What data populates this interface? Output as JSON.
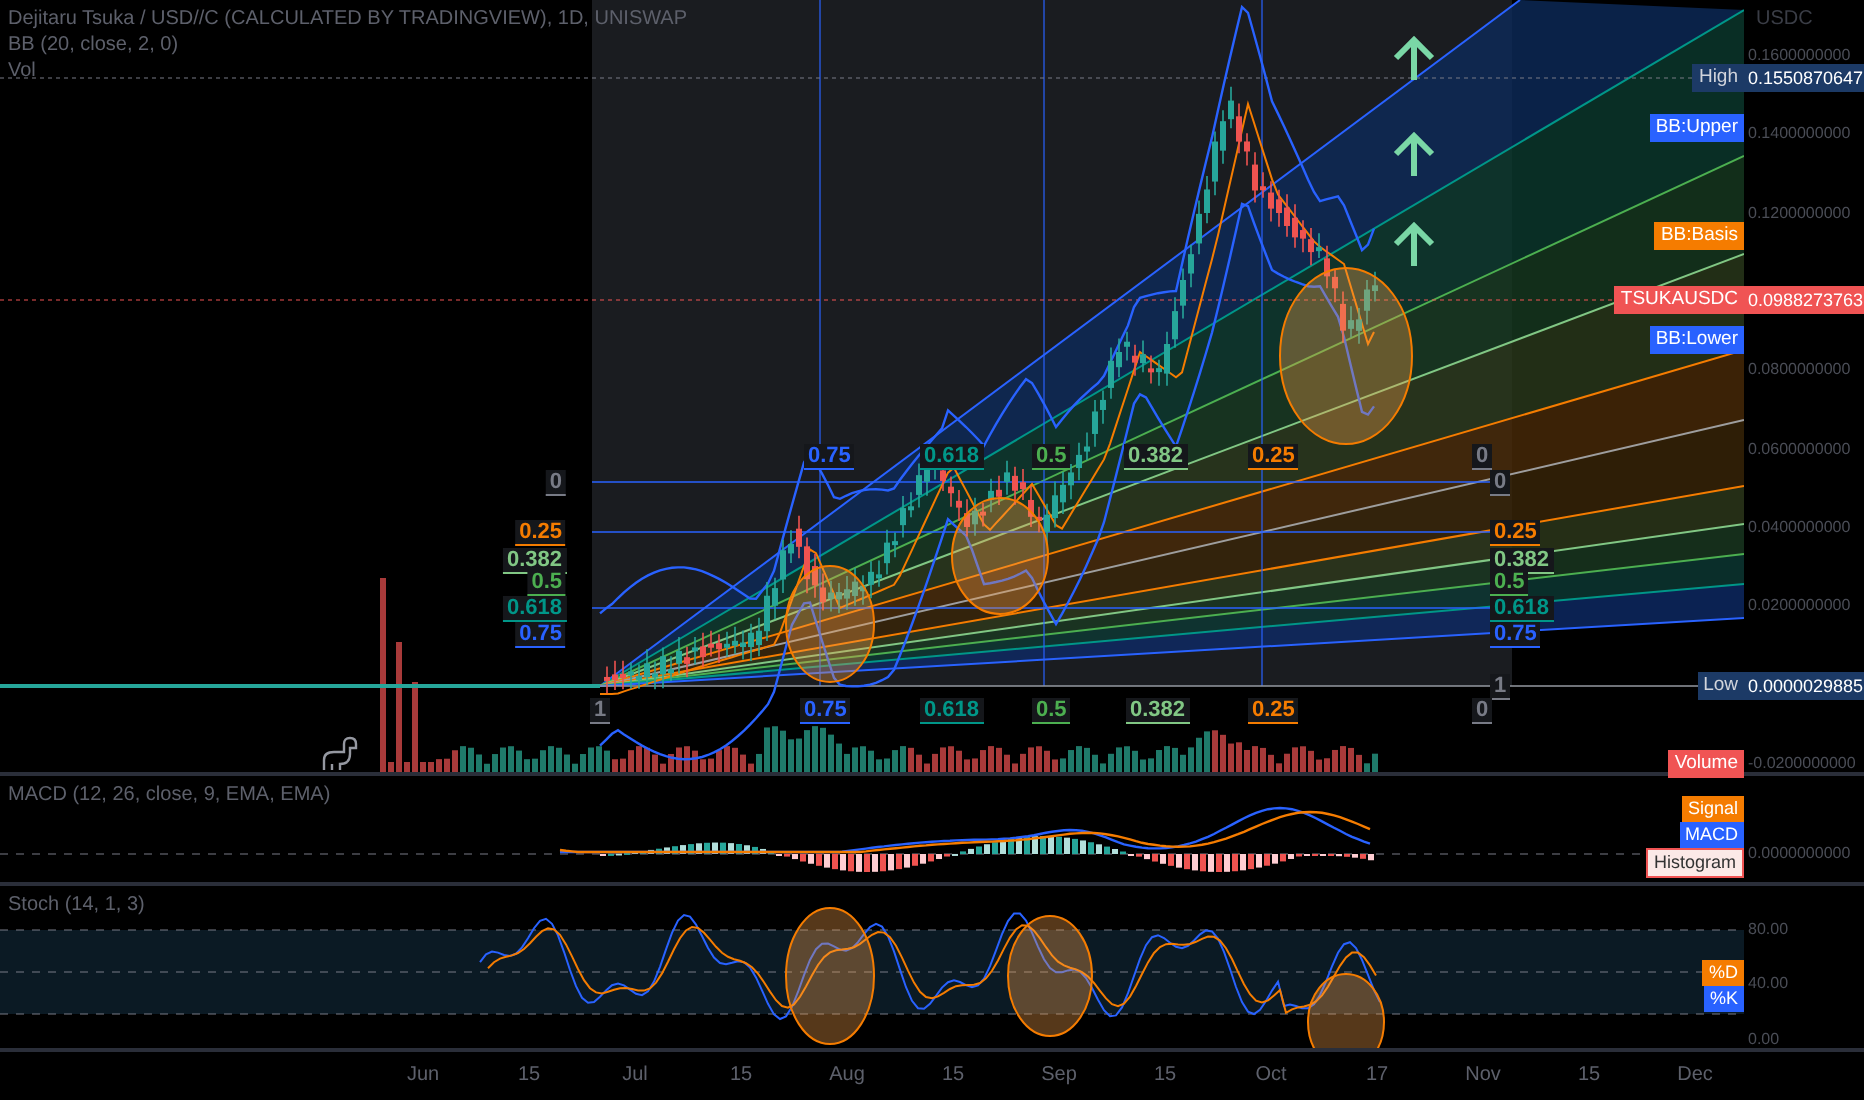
{
  "legend": {
    "title": "Dejitaru Tsuka / USD//C (CALCULATED BY TRADINGVIEW), 1D, UNISWAP",
    "indicators": [
      "BB (20, close, 2, 0)",
      "Vol"
    ]
  },
  "price_axis": {
    "unit": "USDC",
    "ticks": [
      "0.1600000000",
      "0.1400000000",
      "0.1200000000",
      "0.0800000000",
      "0.0600000000",
      "0.0400000000",
      "0.0200000000",
      "-0.0200000000"
    ]
  },
  "price_markers": [
    {
      "kind": "range",
      "label": "High",
      "value": "0.1550870647",
      "color": "#1c3a66"
    },
    {
      "kind": "series",
      "label": "BB:Upper",
      "color": "#2962ff"
    },
    {
      "kind": "series",
      "label": "BB:Basis",
      "color": "#f57c00"
    },
    {
      "kind": "last",
      "label": "TSUKAUSDC",
      "value": "0.0988273763",
      "color": "#f05454"
    },
    {
      "kind": "series",
      "label": "BB:Lower",
      "color": "#2962ff"
    },
    {
      "kind": "range",
      "label": "Low",
      "value": "0.0000029885",
      "color": "#1c3a66"
    },
    {
      "kind": "series",
      "label": "Volume",
      "color": "#f05454"
    }
  ],
  "fib_labels": {
    "left": [
      {
        "label": "0",
        "color": "#787b86"
      },
      {
        "label": "0.25",
        "color": "#f57c00"
      },
      {
        "label": "0.382",
        "color": "#81c784"
      },
      {
        "label": "0.5",
        "color": "#4caf50"
      },
      {
        "label": "0.618",
        "color": "#009688"
      },
      {
        "label": "0.75",
        "color": "#2962ff"
      }
    ],
    "right": [
      {
        "label": "0",
        "color": "#787b86"
      },
      {
        "label": "0.25",
        "color": "#f57c00"
      },
      {
        "label": "0.382",
        "color": "#81c784"
      },
      {
        "label": "0.5",
        "color": "#4caf50"
      },
      {
        "label": "0.618",
        "color": "#009688"
      },
      {
        "label": "0.75",
        "color": "#2962ff"
      },
      {
        "label": "1",
        "color": "#787b86"
      }
    ],
    "top": [
      {
        "label": "0.75",
        "color": "#2962ff"
      },
      {
        "label": "0.618",
        "color": "#009688"
      },
      {
        "label": "0.5",
        "color": "#4caf50"
      },
      {
        "label": "0.382",
        "color": "#81c784"
      },
      {
        "label": "0.25",
        "color": "#f57c00"
      },
      {
        "label": "0",
        "color": "#787b86"
      }
    ],
    "bottom": [
      {
        "label": "1",
        "color": "#787b86"
      },
      {
        "label": "0.75",
        "color": "#2962ff"
      },
      {
        "label": "0.618",
        "color": "#009688"
      },
      {
        "label": "0.5",
        "color": "#4caf50"
      },
      {
        "label": "0.382",
        "color": "#81c784"
      },
      {
        "label": "0.25",
        "color": "#f57c00"
      },
      {
        "label": "0",
        "color": "#787b86"
      }
    ]
  },
  "macd": {
    "title": "MACD (12, 26, close, 9, EMA, EMA)",
    "ticks": [
      "0.0000000000"
    ],
    "markers": [
      {
        "label": "Signal",
        "color": "#f57c00"
      },
      {
        "label": "MACD",
        "color": "#2962ff"
      },
      {
        "label": "Histogram",
        "color": "#fbe9e7"
      }
    ]
  },
  "stoch": {
    "title": "Stoch (14, 1, 3)",
    "ticks": [
      "80.00",
      "40.00",
      "0.00"
    ],
    "markers": [
      {
        "label": "%D",
        "color": "#f57c00"
      },
      {
        "label": "%K",
        "color": "#2962ff"
      }
    ]
  },
  "time_axis": [
    "Jun",
    "15",
    "Jul",
    "15",
    "Aug",
    "15",
    "Sep",
    "15",
    "Oct",
    "17",
    "Nov",
    "15",
    "Dec"
  ]
}
